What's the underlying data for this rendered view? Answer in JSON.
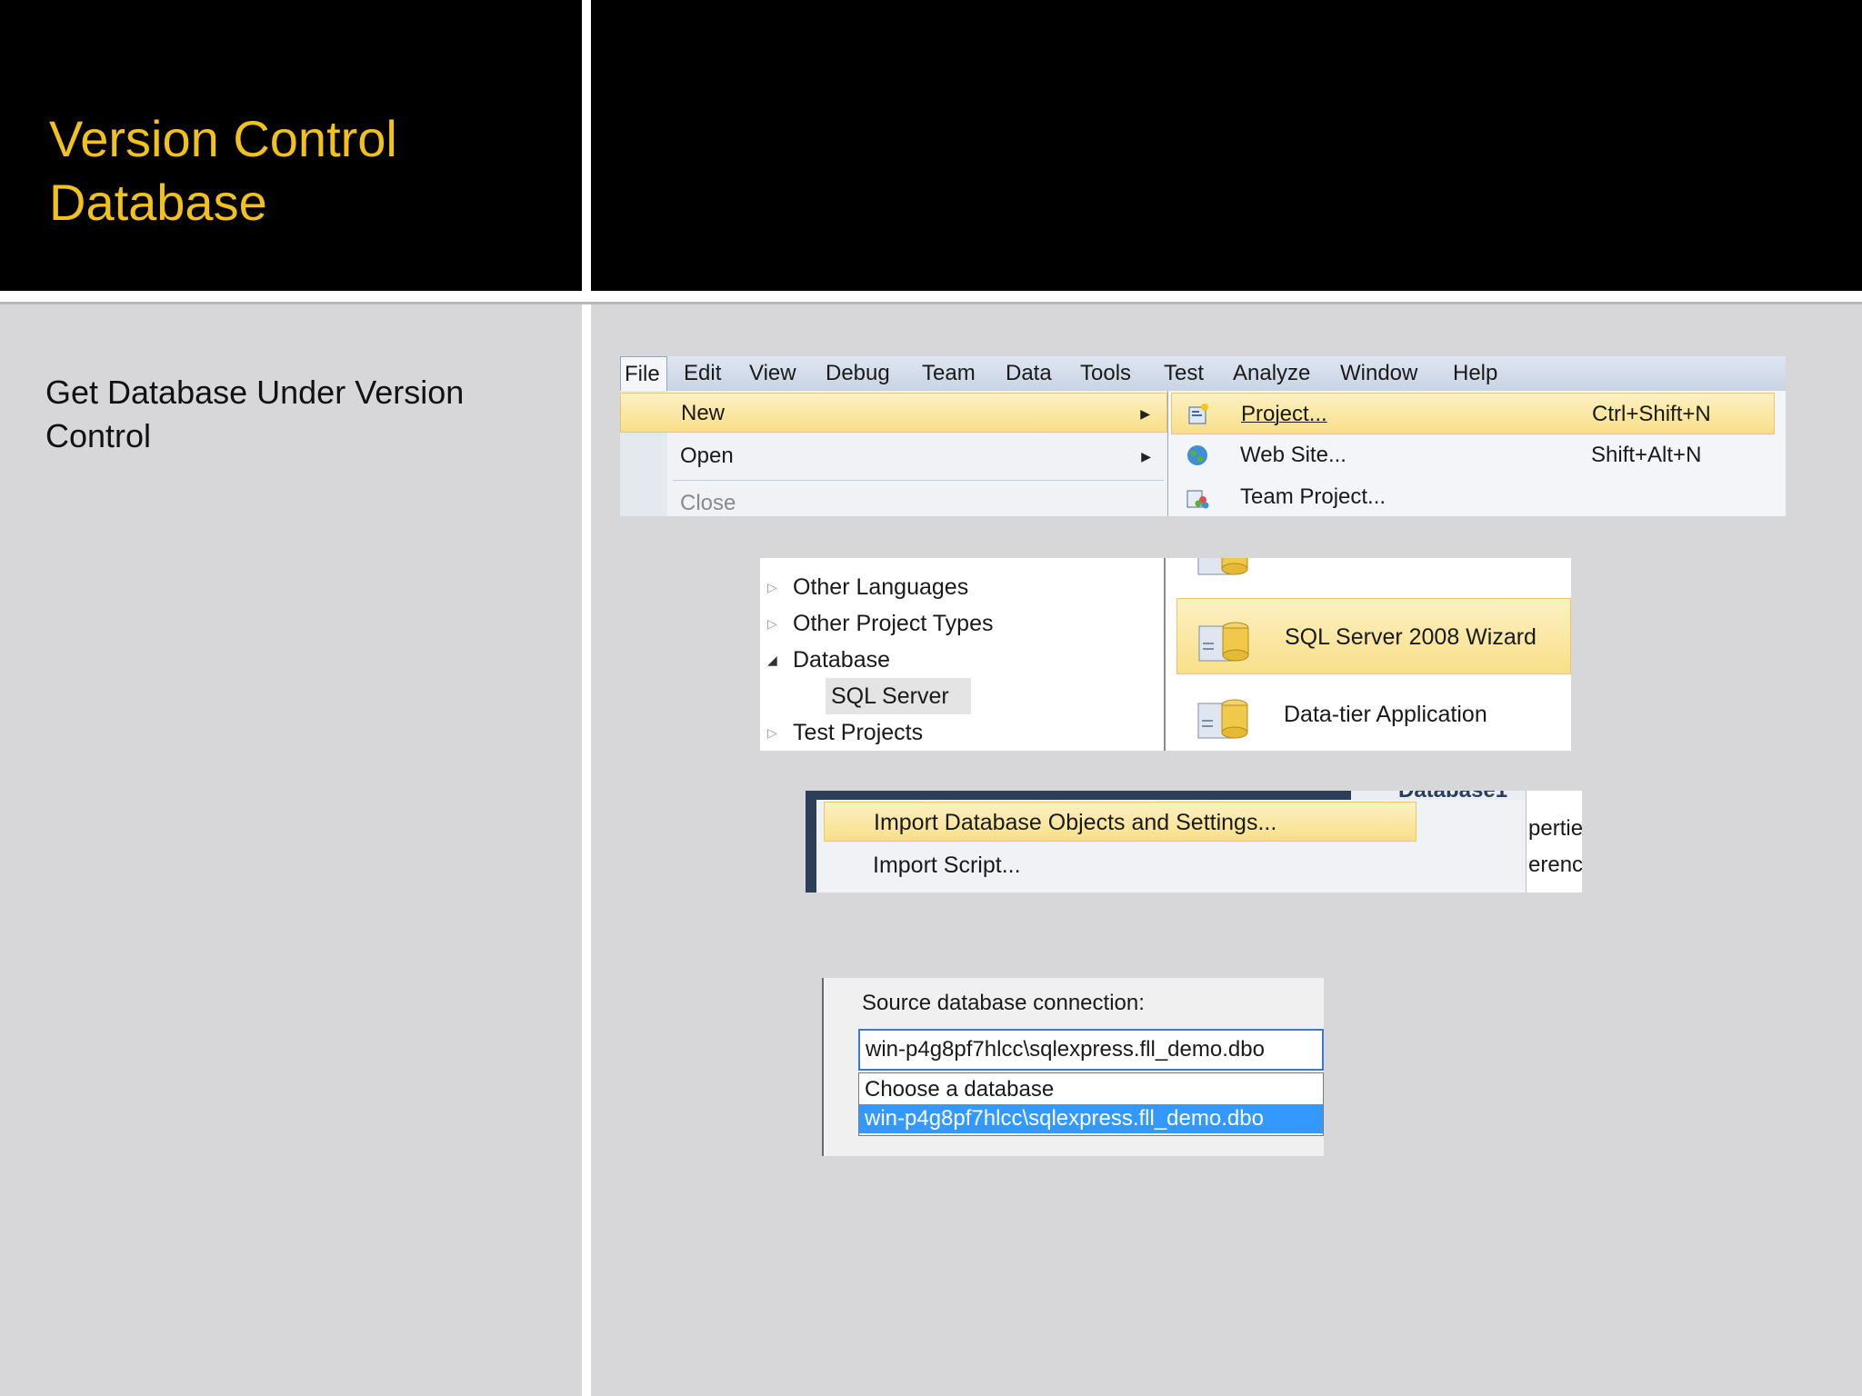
{
  "slide": {
    "title_line1": "Version Control",
    "title_line2": "Database",
    "body_line1": "Get Database Under Version",
    "body_line2": "Control",
    "accent_color": "#f2c21b"
  },
  "menu_shot": {
    "menubar": [
      "File",
      "Edit",
      "View",
      "Debug",
      "Team",
      "Data",
      "Tools",
      "Test",
      "Analyze",
      "Window",
      "Help"
    ],
    "file_menu": [
      {
        "label": "New",
        "has_submenu": true
      },
      {
        "label": "Open",
        "has_submenu": true
      },
      {
        "label": "Close",
        "has_submenu": false
      }
    ],
    "new_submenu": [
      {
        "label": "Project...",
        "shortcut": "Ctrl+Shift+N",
        "icon": "project-icon"
      },
      {
        "label": "Web Site...",
        "shortcut": "Shift+Alt+N",
        "icon": "globe-icon"
      },
      {
        "label": "Team Project...",
        "shortcut": "",
        "icon": "team-project-icon"
      }
    ]
  },
  "types_shot": {
    "tree": [
      "Other Languages",
      "Other Project Types",
      "Database",
      "SQL Server",
      "Test Projects"
    ],
    "templates": [
      "SQL Server 2008 Wizard",
      "Data-tier Application"
    ]
  },
  "import_shot": {
    "items": [
      "Import Database Objects and Settings...",
      "Import Script..."
    ],
    "partial_header": "Database1",
    "partial_side_1": "pertie",
    "partial_side_2": "erenc"
  },
  "conn_shot": {
    "label": "Source database connection:",
    "selected": "win-p4g8pf7hlcc\\sqlexpress.fll_demo.dbo",
    "options": [
      "Choose a database",
      "win-p4g8pf7hlcc\\sqlexpress.fll_demo.dbo"
    ]
  }
}
